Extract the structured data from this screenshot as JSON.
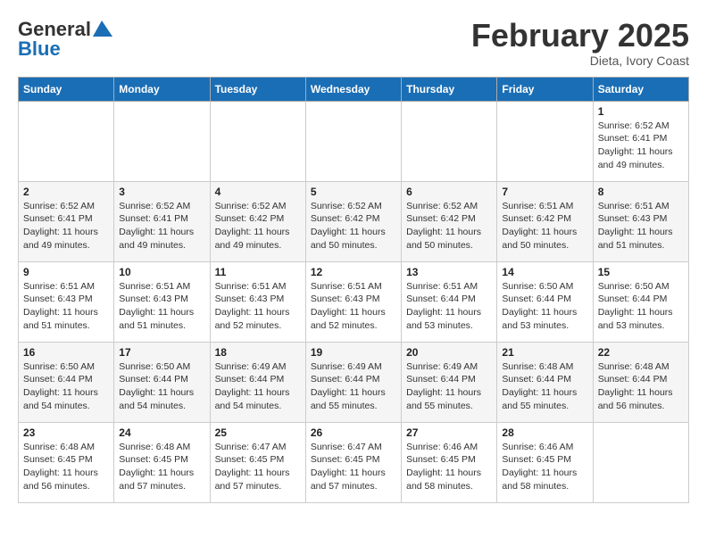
{
  "header": {
    "logo_general": "General",
    "logo_blue": "Blue",
    "month_title": "February 2025",
    "subtitle": "Dieta, Ivory Coast"
  },
  "weekdays": [
    "Sunday",
    "Monday",
    "Tuesday",
    "Wednesday",
    "Thursday",
    "Friday",
    "Saturday"
  ],
  "weeks": [
    [
      {
        "day": "",
        "info": ""
      },
      {
        "day": "",
        "info": ""
      },
      {
        "day": "",
        "info": ""
      },
      {
        "day": "",
        "info": ""
      },
      {
        "day": "",
        "info": ""
      },
      {
        "day": "",
        "info": ""
      },
      {
        "day": "1",
        "info": "Sunrise: 6:52 AM\nSunset: 6:41 PM\nDaylight: 11 hours\nand 49 minutes."
      }
    ],
    [
      {
        "day": "2",
        "info": "Sunrise: 6:52 AM\nSunset: 6:41 PM\nDaylight: 11 hours\nand 49 minutes."
      },
      {
        "day": "3",
        "info": "Sunrise: 6:52 AM\nSunset: 6:41 PM\nDaylight: 11 hours\nand 49 minutes."
      },
      {
        "day": "4",
        "info": "Sunrise: 6:52 AM\nSunset: 6:42 PM\nDaylight: 11 hours\nand 49 minutes."
      },
      {
        "day": "5",
        "info": "Sunrise: 6:52 AM\nSunset: 6:42 PM\nDaylight: 11 hours\nand 50 minutes."
      },
      {
        "day": "6",
        "info": "Sunrise: 6:52 AM\nSunset: 6:42 PM\nDaylight: 11 hours\nand 50 minutes."
      },
      {
        "day": "7",
        "info": "Sunrise: 6:51 AM\nSunset: 6:42 PM\nDaylight: 11 hours\nand 50 minutes."
      },
      {
        "day": "8",
        "info": "Sunrise: 6:51 AM\nSunset: 6:43 PM\nDaylight: 11 hours\nand 51 minutes."
      }
    ],
    [
      {
        "day": "9",
        "info": "Sunrise: 6:51 AM\nSunset: 6:43 PM\nDaylight: 11 hours\nand 51 minutes."
      },
      {
        "day": "10",
        "info": "Sunrise: 6:51 AM\nSunset: 6:43 PM\nDaylight: 11 hours\nand 51 minutes."
      },
      {
        "day": "11",
        "info": "Sunrise: 6:51 AM\nSunset: 6:43 PM\nDaylight: 11 hours\nand 52 minutes."
      },
      {
        "day": "12",
        "info": "Sunrise: 6:51 AM\nSunset: 6:43 PM\nDaylight: 11 hours\nand 52 minutes."
      },
      {
        "day": "13",
        "info": "Sunrise: 6:51 AM\nSunset: 6:44 PM\nDaylight: 11 hours\nand 53 minutes."
      },
      {
        "day": "14",
        "info": "Sunrise: 6:50 AM\nSunset: 6:44 PM\nDaylight: 11 hours\nand 53 minutes."
      },
      {
        "day": "15",
        "info": "Sunrise: 6:50 AM\nSunset: 6:44 PM\nDaylight: 11 hours\nand 53 minutes."
      }
    ],
    [
      {
        "day": "16",
        "info": "Sunrise: 6:50 AM\nSunset: 6:44 PM\nDaylight: 11 hours\nand 54 minutes."
      },
      {
        "day": "17",
        "info": "Sunrise: 6:50 AM\nSunset: 6:44 PM\nDaylight: 11 hours\nand 54 minutes."
      },
      {
        "day": "18",
        "info": "Sunrise: 6:49 AM\nSunset: 6:44 PM\nDaylight: 11 hours\nand 54 minutes."
      },
      {
        "day": "19",
        "info": "Sunrise: 6:49 AM\nSunset: 6:44 PM\nDaylight: 11 hours\nand 55 minutes."
      },
      {
        "day": "20",
        "info": "Sunrise: 6:49 AM\nSunset: 6:44 PM\nDaylight: 11 hours\nand 55 minutes."
      },
      {
        "day": "21",
        "info": "Sunrise: 6:48 AM\nSunset: 6:44 PM\nDaylight: 11 hours\nand 55 minutes."
      },
      {
        "day": "22",
        "info": "Sunrise: 6:48 AM\nSunset: 6:44 PM\nDaylight: 11 hours\nand 56 minutes."
      }
    ],
    [
      {
        "day": "23",
        "info": "Sunrise: 6:48 AM\nSunset: 6:45 PM\nDaylight: 11 hours\nand 56 minutes."
      },
      {
        "day": "24",
        "info": "Sunrise: 6:48 AM\nSunset: 6:45 PM\nDaylight: 11 hours\nand 57 minutes."
      },
      {
        "day": "25",
        "info": "Sunrise: 6:47 AM\nSunset: 6:45 PM\nDaylight: 11 hours\nand 57 minutes."
      },
      {
        "day": "26",
        "info": "Sunrise: 6:47 AM\nSunset: 6:45 PM\nDaylight: 11 hours\nand 57 minutes."
      },
      {
        "day": "27",
        "info": "Sunrise: 6:46 AM\nSunset: 6:45 PM\nDaylight: 11 hours\nand 58 minutes."
      },
      {
        "day": "28",
        "info": "Sunrise: 6:46 AM\nSunset: 6:45 PM\nDaylight: 11 hours\nand 58 minutes."
      },
      {
        "day": "",
        "info": ""
      }
    ]
  ]
}
